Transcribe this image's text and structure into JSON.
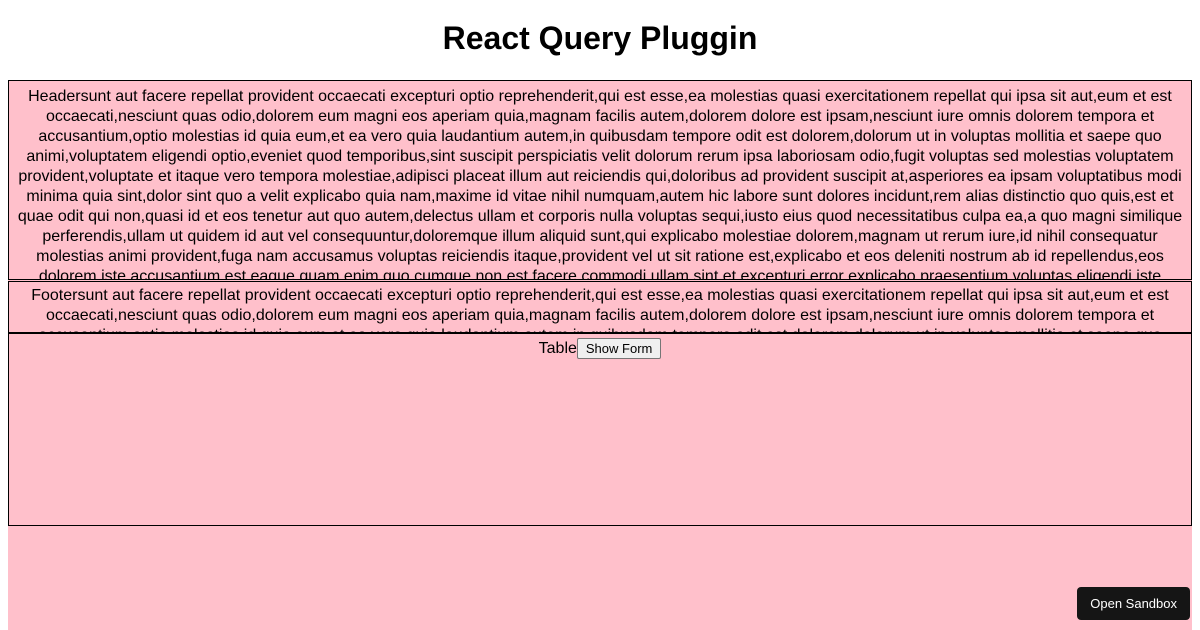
{
  "title": "React Query Pluggin",
  "header_text": "Headersunt aut facere repellat provident occaecati excepturi optio reprehenderit,qui est esse,ea molestias quasi exercitationem repellat qui ipsa sit aut,eum et est occaecati,nesciunt quas odio,dolorem eum magni eos aperiam quia,magnam facilis autem,dolorem dolore est ipsam,nesciunt iure omnis dolorem tempora et accusantium,optio molestias id quia eum,et ea vero quia laudantium autem,in quibusdam tempore odit est dolorem,dolorum ut in voluptas mollitia et saepe quo animi,voluptatem eligendi optio,eveniet quod temporibus,sint suscipit perspiciatis velit dolorum rerum ipsa laboriosam odio,fugit voluptas sed molestias voluptatem provident,voluptate et itaque vero tempora molestiae,adipisci placeat illum aut reiciendis qui,doloribus ad provident suscipit at,asperiores ea ipsam voluptatibus modi minima quia sint,dolor sint quo a velit explicabo quia nam,maxime id vitae nihil numquam,autem hic labore sunt dolores incidunt,rem alias distinctio quo quis,est et quae odit qui non,quasi id et eos tenetur aut quo autem,delectus ullam et corporis nulla voluptas sequi,iusto eius quod necessitatibus culpa ea,a quo magni similique perferendis,ullam ut quidem id aut vel consequuntur,doloremque illum aliquid sunt,qui explicabo molestiae dolorem,magnam ut rerum iure,id nihil consequatur molestias animi provident,fuga nam accusamus voluptas reiciendis itaque,provident vel ut sit ratione est,explicabo et eos deleniti nostrum ab id repellendus,eos dolorem iste accusantium est eaque quam,enim quo cumque,non est facere,commodi ullam sint et excepturi error explicabo praesentium voluptas,eligendi iste nostrum consequuntur adipisci praesentium sit beatae perferendis,optio dolor molestias sit,ut numquam possimus omnis eius suscipit laudantium iure,aut quo modi neque nostrum",
  "footer_text": "Footersunt aut facere repellat provident occaecati excepturi optio reprehenderit,qui est esse,ea molestias quasi exercitationem repellat qui ipsa sit aut,eum et est occaecati,nesciunt quas odio,dolorem eum magni eos aperiam quia,magnam facilis autem,dolorem dolore est ipsam,nesciunt iure omnis dolorem tempora et accusantium,optio molestias id quia eum,et ea vero quia laudantium autem,in quibusdam tempore odit est dolorem,dolorum ut in voluptas mollitia et saepe quo",
  "table_label": "Table",
  "show_form_label": "Show Form",
  "open_sandbox_label": "Open Sandbox"
}
